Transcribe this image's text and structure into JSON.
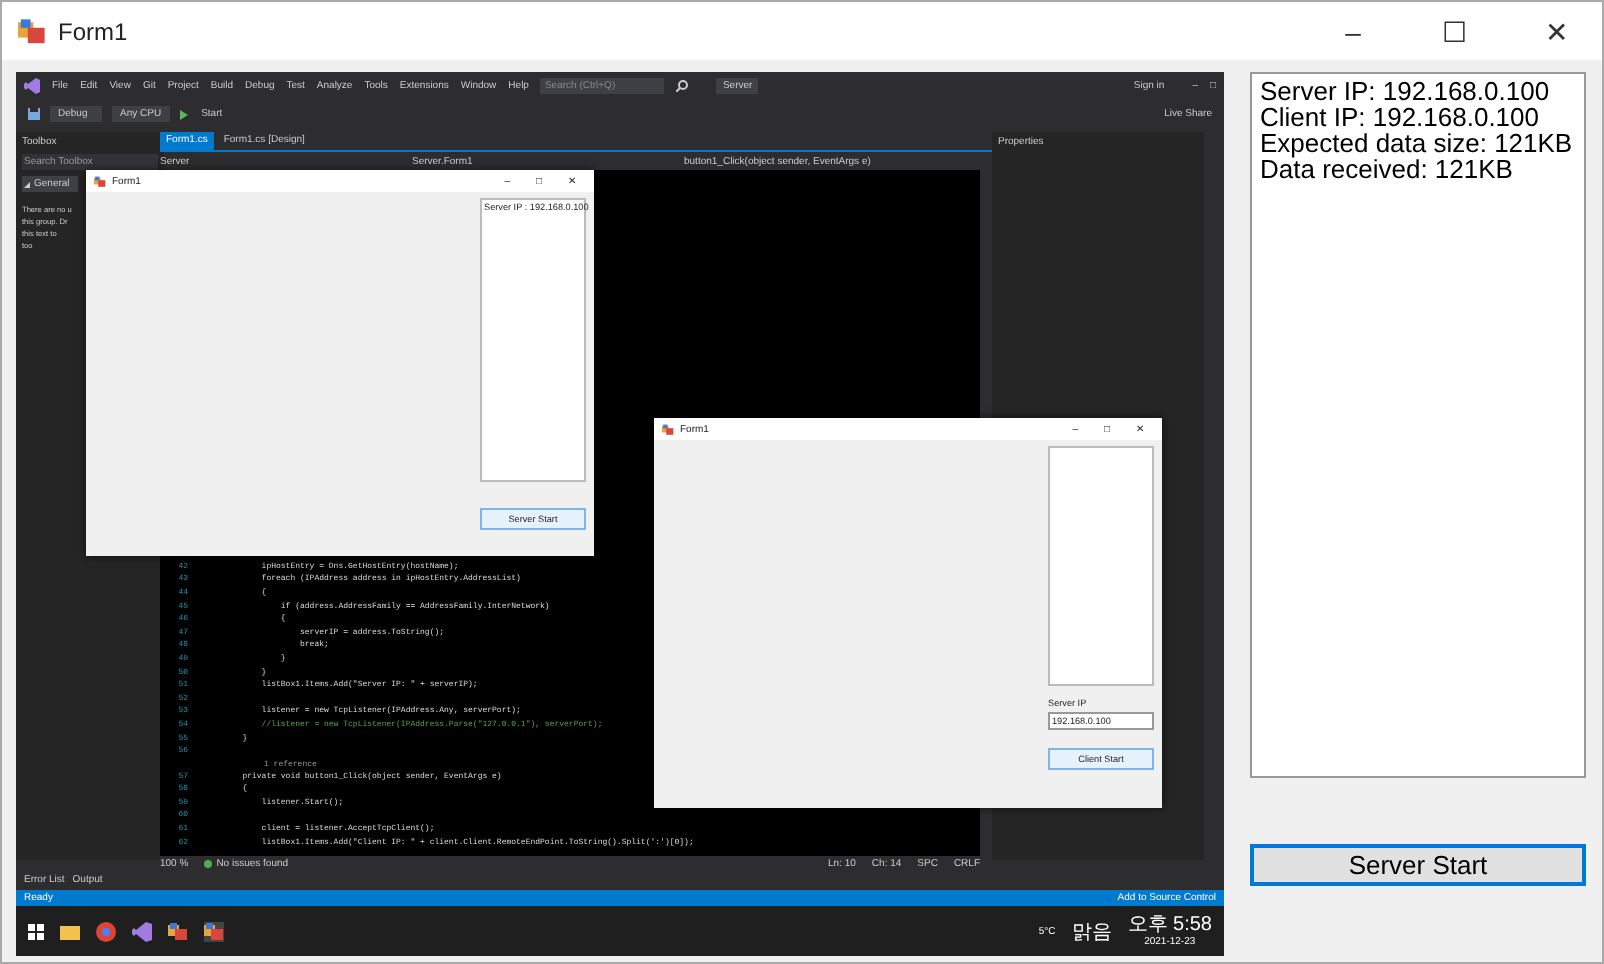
{
  "window": {
    "title": "Form1",
    "controls": [
      "–",
      "☐",
      "✕"
    ]
  },
  "screenshot": {
    "menu": [
      "File",
      "Edit",
      "View",
      "Git",
      "Project",
      "Build",
      "Debug",
      "Test",
      "Analyze",
      "Tools",
      "Extensions",
      "Window",
      "Help"
    ],
    "search_placeholder": "Search (Ctrl+Q)",
    "solution": "Server",
    "sign_in": "Sign in",
    "controls": [
      "–",
      "□"
    ],
    "toolbar": [
      "Debug",
      "Any CPU",
      "Start"
    ],
    "live_share": "Live Share",
    "toolbox": {
      "title": "Toolbox",
      "search_placeholder": "Search Toolbox",
      "group": "General",
      "note": [
        "There are no u",
        "this group. Dr",
        "this text to",
        "too"
      ]
    },
    "doc_tabs": [
      {
        "label": "Form1.cs",
        "selected": true
      },
      {
        "label": "Form1.cs [Design]",
        "selected": false
      }
    ],
    "nav": [
      "Server",
      "Server.Form1",
      "button1_Click(object sender, EventArgs e)"
    ],
    "code": [
      {
        "line": "42",
        "text": "            ipHostEntry = Dns.GetHostEntry(hostName);"
      },
      {
        "line": "43",
        "text": "            foreach (IPAddress address in ipHostEntry.AddressList)"
      },
      {
        "line": "44",
        "text": "            {"
      },
      {
        "line": "45",
        "text": "                if (address.AddressFamily == AddressFamily.InterNetwork)"
      },
      {
        "line": "46",
        "text": "                {"
      },
      {
        "line": "47",
        "text": "                    serverIP = address.ToString();"
      },
      {
        "line": "48",
        "text": "                    break;"
      },
      {
        "line": "49",
        "text": "                }"
      },
      {
        "line": "50",
        "text": "            }"
      },
      {
        "line": "51",
        "text": "            listBox1.Items.Add(\"Server IP: \" + serverIP);"
      },
      {
        "line": "52"
      },
      {
        "line": "53",
        "text": "            listener = new TcpListener(IPAddress.Any, serverPort);"
      },
      {
        "line": "54",
        "text": "            //listener = new TcpListener(IPAddress.Parse(\"127.0.0.1\"), serverPort);"
      },
      {
        "line": "55",
        "text": "        }"
      },
      {
        "line": "56"
      },
      {
        "line": "57",
        "text": "        private void button1_Click(object sender, EventArgs e)",
        "ref": "1 reference"
      },
      {
        "line": "58",
        "text": "        {"
      },
      {
        "line": "59",
        "text": "            listener.Start();"
      },
      {
        "line": "60"
      },
      {
        "line": "61",
        "text": "            client = listener.AcceptTcpClient();"
      },
      {
        "line": "62",
        "text": "            listBox1.Items.Add(\"Client IP: \" + client.Client.RemoteEndPoint.ToString().Split(':')[0]);"
      }
    ],
    "editor_status": {
      "zoom": "100 %",
      "issues": "No issues found",
      "position": [
        "Ln: 10",
        "Ch: 14",
        "SPC",
        "CRLF"
      ]
    },
    "properties_title": "Properties",
    "bottom_tabs": [
      "Error List",
      "Output"
    ],
    "status": {
      "text": "Ready",
      "source_control": "Add to Source Control"
    },
    "taskbar": {
      "weather": "5°C",
      "weather_text": "맑음",
      "time": "오후 5:58",
      "date": "2021-12-23"
    },
    "server_form": {
      "title": "Form1",
      "controls": [
        "–",
        "□",
        "✕"
      ],
      "list": [
        "Server IP : 192.168.0.100"
      ],
      "button": "Server Start"
    },
    "client_form": {
      "title": "Form1",
      "controls": [
        "–",
        "□",
        "✕"
      ],
      "label": "Server IP",
      "input": "192.168.0.100",
      "button": "Client Start"
    }
  },
  "list": [
    "Server IP: 192.168.0.100",
    "Client IP: 192.168.0.100",
    "Expected data size: 121KB",
    "Data received: 121KB"
  ],
  "button": "Server Start"
}
